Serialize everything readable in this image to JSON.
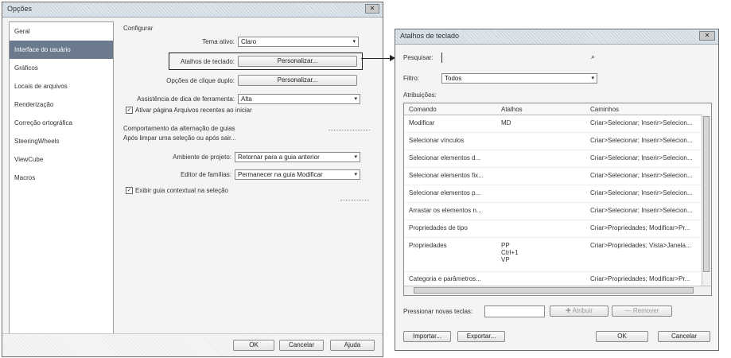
{
  "options_dialog": {
    "title": "Opções",
    "window_buttons": {
      "close": "✕"
    },
    "sidebar": [
      "Geral",
      "Interface do usuário",
      "Gráficos",
      "Locais de arquivos",
      "Renderização",
      "Correção ortográfica",
      "SteeringWheels",
      "ViewCube",
      "Macros"
    ],
    "selected_index": 1,
    "configure_label": "Configurar",
    "theme": {
      "label": "Tema ativo:",
      "value": "Claro"
    },
    "shortcuts": {
      "label": "Atalhos de teclado:",
      "button": "Personalizar..."
    },
    "double_click": {
      "label": "Opções de clique duplo:",
      "button": "Personalizar..."
    },
    "tooltip_assist": {
      "label": "Assistência de dica de ferramenta:",
      "value": "Alta"
    },
    "recent_files_checkbox": "Ativar página Arquivos recentes ao iniciar",
    "tab_behavior_heading": "Comportamento da alternação de guias",
    "after_clear_label": "Após limpar uma seleção ou após sair...",
    "project_env": {
      "label": "Ambiente de projeto:",
      "value": "Retornar para a guia anterior"
    },
    "family_editor": {
      "label": "Editor de famílias:",
      "value": "Permanecer na guia Modificar"
    },
    "contextual_tab_checkbox": "Exibir guia contextual na seleção",
    "buttons": {
      "ok": "OK",
      "cancel": "Cancelar",
      "help": "Ajuda"
    }
  },
  "shortcuts_dialog": {
    "title": "Atalhos de teclado",
    "search": {
      "label": "Pesquisar:",
      "value": ""
    },
    "filter": {
      "label": "Filtro:",
      "value": "Todos"
    },
    "assignments_label": "Atribuições:",
    "columns": [
      "Comando",
      "Atalhos",
      "Caminhos"
    ],
    "rows": [
      {
        "command": "Modificar",
        "shortcut": "MD",
        "path": "Criar>Selecionar; Inserir>Selecion..."
      },
      {
        "command": "Selecionar vínculos",
        "shortcut": "",
        "path": "Criar>Selecionar; Inserir>Selecion..."
      },
      {
        "command": "Selecionar elementos d...",
        "shortcut": "",
        "path": "Criar>Selecionar; Inserir>Selecion..."
      },
      {
        "command": "Selecionar elementos fix...",
        "shortcut": "",
        "path": "Criar>Selecionar; Inserir>Selecion..."
      },
      {
        "command": "Selecionar elementos p...",
        "shortcut": "",
        "path": "Criar>Selecionar; Inserir>Selecion..."
      },
      {
        "command": "Arrastar os elementos n...",
        "shortcut": "",
        "path": "Criar>Selecionar; Inserir>Selecion..."
      },
      {
        "command": "Propriedades de tipo",
        "shortcut": "",
        "path": "Criar>Propriedades; Modificar>Pr..."
      },
      {
        "command": "Propriedades",
        "shortcut": "PP\nCtrl+1\nVP",
        "path": "Criar>Propriedades; Vista>Janela..."
      },
      {
        "command": "Categoria e parâmetros...",
        "shortcut": "",
        "path": "Criar>Propriedades; Modificar>Pr..."
      }
    ],
    "press_new_keys_label": "Pressionar novas teclas:",
    "assign_button": "Atribuir",
    "remove_button": "Remover",
    "buttons": {
      "import": "Importar...",
      "export": "Exportar...",
      "ok": "OK",
      "cancel": "Cancelar"
    }
  }
}
